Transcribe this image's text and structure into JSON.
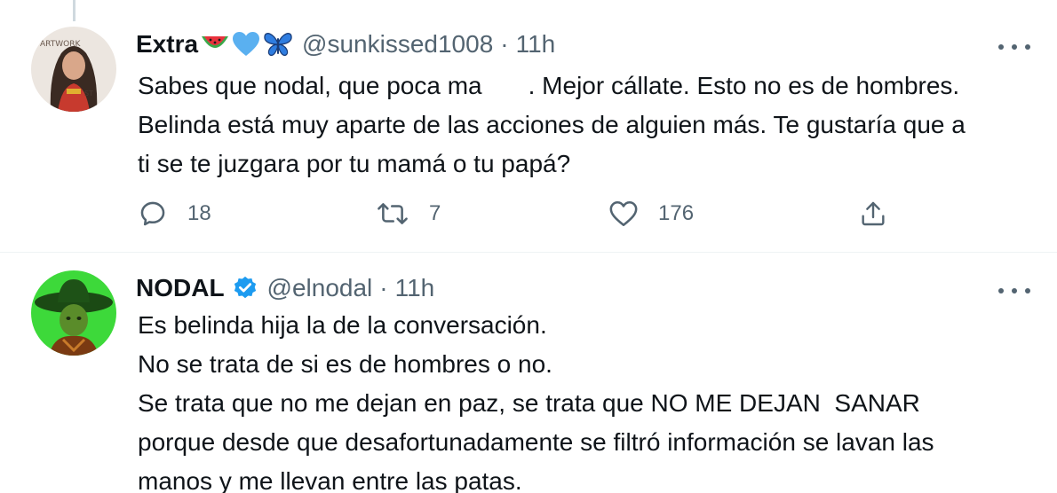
{
  "tweets": [
    {
      "display_name": "Extra",
      "emojis": [
        "watermelon-icon",
        "blue-heart-icon",
        "butterfly-icon"
      ],
      "handle": "@sunkissed1008",
      "separator": "·",
      "time": "11h",
      "lines": [
        [
          "Sabes que nodal, que poca ma",
          ". Mejor cállate. Esto no es de hombres."
        ],
        "Belinda está muy aparte de las acciones de alguien más. Te gustaría que a",
        "ti se te juzgara por tu mamá o tu papá?"
      ],
      "actions": {
        "replies": "18",
        "retweets": "7",
        "likes": "176"
      }
    },
    {
      "display_name": "NODAL",
      "verified": true,
      "handle": "@elnodal",
      "separator": "·",
      "time": "11h",
      "lines": [
        "Es belinda hija la de la conversación.",
        "No se trata de si es de hombres o no.",
        "Se trata que no me dejan en paz, se trata que NO ME DEJAN  SANAR",
        "porque desde que desafortunadamente se filtró información se lavan las",
        "manos y me llevan entre las patas."
      ]
    }
  ],
  "colors": {
    "text": "#0f1419",
    "secondary": "#536471",
    "verified": "#1d9bf0",
    "heart": "#5ab0f0",
    "divider": "#eff3f4"
  }
}
